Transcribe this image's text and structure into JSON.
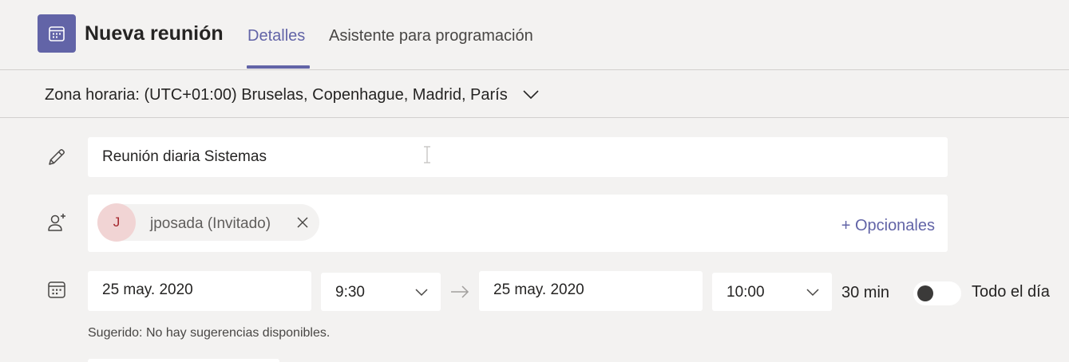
{
  "header": {
    "app_icon": "calendar-icon",
    "title": "Nueva reunión",
    "tabs": [
      {
        "label": "Detalles",
        "active": true
      },
      {
        "label": "Asistente para programación",
        "active": false
      }
    ]
  },
  "timezone": {
    "label": "Zona horaria: (UTC+01:00) Bruselas, Copenhague, Madrid, París"
  },
  "meeting": {
    "title_value": "Reunión diaria Sistemas",
    "attendees": [
      {
        "initial": "J",
        "name": "jposada (Invitado)"
      }
    ],
    "optionals_label": "+ Opcionales",
    "start_date": "25 may. 2020",
    "start_time": "9:30",
    "end_date": "25 may. 2020",
    "end_time": "10:00",
    "duration": "30 min",
    "all_day_label": "Todo el día",
    "all_day_on": false,
    "suggestion": "Sugerido: No hay sugerencias disponibles."
  },
  "colors": {
    "accent": "#6264a7",
    "background": "#f3f2f1",
    "field": "#ffffff",
    "avatar_bg": "#f1d4d4",
    "avatar_text": "#a4262c"
  }
}
